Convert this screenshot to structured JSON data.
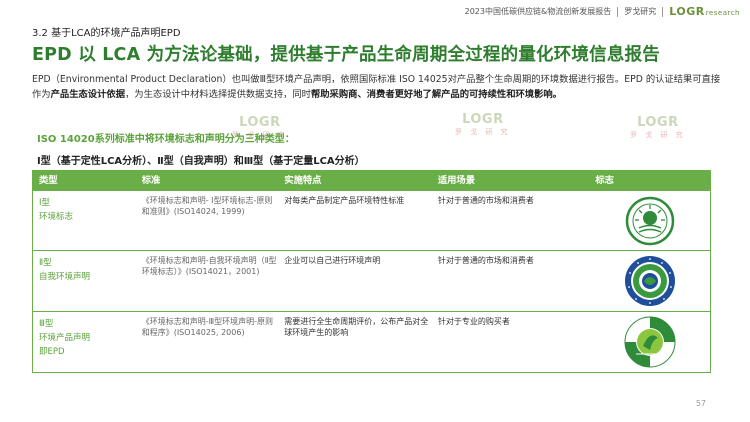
{
  "header": {
    "report_title": "2023中国低碳供应链&物流创新发展报告",
    "brand_cn": "罗戈研究",
    "logo_text": "LOGR",
    "logo_suffix": "research"
  },
  "section_title": "3.2 基于LCA的环境产品声明EPD",
  "main_title": "EPD 以 LCA 为方法论基础，提供基于产品生命周期全过程的量化环境信息报告",
  "paragraph": {
    "p1": "EPD（Environmental Product Declaration）也叫做Ⅲ型环境产品声明，依照国际标准 ISO 14025对产品整个生命周期的环境数据进行报告。EPD 的认证结果可直接作为",
    "b1": "产品生态设计依据",
    "p2": "，为生态设计中材料选择提供数据支持，同时",
    "b2": "帮助采购商、消费者更好地了解产品的可持续性和环境影响。"
  },
  "iso_intro": "ISO 14020系列标准中将环境标志和声明分为三种类型：",
  "types_line": "Ⅰ型（基于定性LCA分析）、Ⅱ型（自我声明）和Ⅲ型（基于定量LCA分析）",
  "table": {
    "headers": [
      "类型",
      "标准",
      "实施特点",
      "适用场景",
      "标志"
    ],
    "rows": [
      {
        "type_line1": "Ⅰ型",
        "type_line2": "环境标志",
        "type_line3": "",
        "standard": "《环境标志和声明- Ⅰ型环境标志-原则和准则》(ISO14024, 1999)",
        "feature": "对每类产品制定产品环境特性标准",
        "scenario": "针对于普通的市场和消费者",
        "logo_icon": "china-environmental-labelling-icon"
      },
      {
        "type_line1": "Ⅱ型",
        "type_line2": "自我环境声明",
        "type_line3": "",
        "standard": "《环境标志和声明-自我环境声明（Ⅱ型环境标志）》(ISO14021，2001)",
        "feature": "企业可以自己进行环境声明",
        "scenario": "针对于普通的市场和消费者",
        "logo_icon": "self-declaration-seal-icon"
      },
      {
        "type_line1": "Ⅲ型",
        "type_line2": "环境产品声明",
        "type_line3": "即EPD",
        "standard": "《环境标志和声明-Ⅲ型环境声明-原则和程序》(ISO14025, 2006)",
        "feature": "需要进行全生命周期评价，公布产品对全球环境产生的影响",
        "scenario": "针对于专业的购买者",
        "logo_icon": "ecolabelling-iso14025-icon"
      }
    ]
  },
  "watermark": {
    "sub": "罗 戈 研 究"
  },
  "page_number": "57",
  "colors": {
    "green_title": "#2f7d2f",
    "green_table": "#6aae47",
    "green_text": "#5ba33a"
  }
}
